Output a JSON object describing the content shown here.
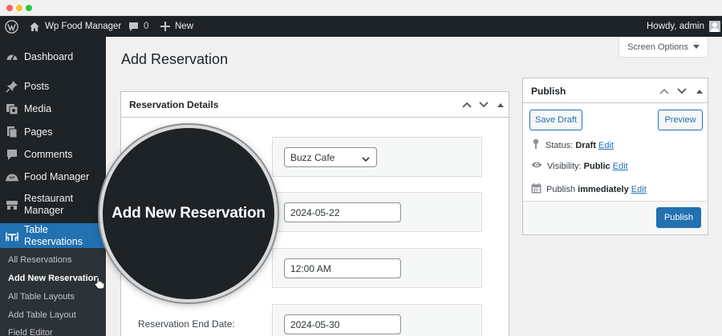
{
  "adminbar": {
    "site_name": "Wp Food Manager",
    "comments_count": "0",
    "new_label": "New",
    "howdy": "Howdy, admin"
  },
  "sidebar": {
    "items": [
      {
        "label": "Dashboard",
        "icon": "dashboard-icon"
      },
      {
        "label": "Posts",
        "icon": "pin-icon"
      },
      {
        "label": "Media",
        "icon": "media-icon"
      },
      {
        "label": "Pages",
        "icon": "pages-icon"
      },
      {
        "label": "Comments",
        "icon": "comment-icon"
      },
      {
        "label": "Food Manager",
        "icon": "food-manager-icon"
      },
      {
        "label": "Restaurant Manager",
        "icon": "restaurant-icon"
      },
      {
        "label": "Table Reservations",
        "icon": "table-icon"
      }
    ],
    "submenu": [
      {
        "label": "All Reservations"
      },
      {
        "label": "Add New Reservation"
      },
      {
        "label": "All Table Layouts"
      },
      {
        "label": "Add Table Layout"
      },
      {
        "label": "Field Editor"
      }
    ]
  },
  "page": {
    "title": "Add Reservation",
    "screen_options": "Screen Options"
  },
  "reservation_details": {
    "title": "Reservation Details",
    "restaurant_value": "Buzz Cafe",
    "date_value": "2024-05-22",
    "time_value": "12:00 AM",
    "end_date_label": "Reservation End Date:",
    "end_date_value": "2024-05-30"
  },
  "publish": {
    "title": "Publish",
    "save_draft": "Save Draft",
    "preview": "Preview",
    "status_label": "Status:",
    "status_value": "Draft",
    "visibility_label": "Visibility:",
    "visibility_value": "Public",
    "publish_label": "Publish",
    "publish_value": "immediately",
    "edit_label": "Edit",
    "publish_button": "Publish"
  },
  "callout": {
    "text": "Add New Reservation"
  },
  "colors": {
    "admin_dark": "#1d2327",
    "accent_blue": "#2271b1",
    "submenu_bg": "#2c3338"
  }
}
